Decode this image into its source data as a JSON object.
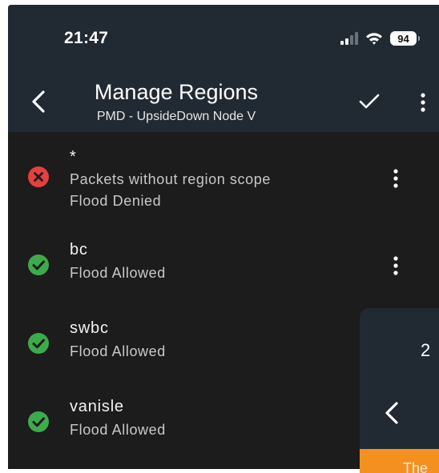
{
  "status_bar": {
    "time": "21:47",
    "battery": "94",
    "icons": [
      "cellular-signal-icon",
      "wifi-icon",
      "battery-icon"
    ]
  },
  "header": {
    "title": "Manage Regions",
    "subtitle": "PMD - UpsideDown Node V",
    "icons": [
      "back-chevron-icon",
      "check-icon",
      "more-vertical-icon"
    ]
  },
  "regions": [
    {
      "name": "*",
      "description": "Packets without region scope",
      "flood": "Flood Denied",
      "status": "denied",
      "has_menu": true
    },
    {
      "name": "bc",
      "description": "",
      "flood": "Flood Allowed",
      "status": "allowed",
      "has_menu": true
    },
    {
      "name": "swbc",
      "description": "",
      "flood": "Flood Allowed",
      "status": "allowed",
      "has_menu": false
    },
    {
      "name": "vanisle",
      "description": "",
      "flood": "Flood Allowed",
      "status": "allowed",
      "has_menu": false
    }
  ],
  "overlay": {
    "number_fragment": "2",
    "banner_fragment": "The"
  },
  "colors": {
    "header_bg": "#212a33",
    "list_bg": "#1c1c1c",
    "allowed": "#3dab4b",
    "denied": "#e5403c",
    "banner": "#f39020"
  }
}
